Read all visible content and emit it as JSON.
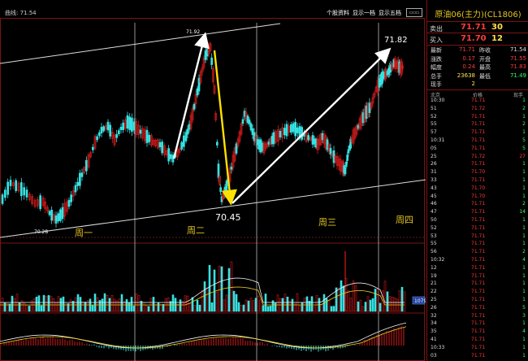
{
  "header": {
    "left_label": "曲线: 71.54",
    "links": [
      "个股资料",
      "显示一档",
      "显示五档"
    ]
  },
  "chart": {
    "annotations": {
      "high_label": "71.82",
      "low_label": "70.45",
      "left_low_label": "70.28",
      "mid_high_label": "71.92",
      "badge": "1079"
    },
    "days": [
      "周一",
      "周二",
      "周三",
      "周四"
    ]
  },
  "quote": {
    "title": "原油06(主力)(CL1806)",
    "sell_label": "卖出",
    "sell_price": "71.71",
    "sell_vol": "30",
    "buy_label": "买入",
    "buy_price": "71.70",
    "buy_vol": "12",
    "stats": [
      {
        "l1": "最新",
        "v1": "71.71",
        "c1": "#ff3b3b",
        "l2": "昨收",
        "v2": "71.54",
        "c2": "#dddddd"
      },
      {
        "l1": "涨跌",
        "v1": "0.17",
        "c1": "#ff3b3b",
        "l2": "开盘",
        "v2": "71.55",
        "c2": "#ff3b3b"
      },
      {
        "l1": "幅度",
        "v1": "0.24",
        "c1": "#ff3b3b",
        "l2": "最高",
        "v2": "71.83",
        "c2": "#ff3b3b"
      },
      {
        "l1": "总手",
        "v1": "23638",
        "c1": "#ffe14a",
        "l2": "最低",
        "v2": "71.49",
        "c2": "#3dff6b"
      },
      {
        "l1": "现手",
        "v1": "2",
        "c1": "#ffe14a",
        "l2": "",
        "v2": "",
        "c2": "#dddddd"
      }
    ],
    "tick_header": [
      "北京",
      "价格",
      "现手"
    ],
    "ticks": [
      {
        "t": "10:30",
        "p": "71.71",
        "v": "1",
        "pc": "#ff3b3b",
        "vc": "#3dff6b"
      },
      {
        "t": "51",
        "p": "71.72",
        "v": "2",
        "pc": "#ff3b3b",
        "vc": "#3dff6b"
      },
      {
        "t": "52",
        "p": "71.71",
        "v": "1",
        "pc": "#ff3b3b",
        "vc": "#3dff6b"
      },
      {
        "t": "55",
        "p": "71.71",
        "v": "2",
        "pc": "#ff3b3b",
        "vc": "#3dff6b"
      },
      {
        "t": "57",
        "p": "71.71",
        "v": "1",
        "pc": "#ff3b3b",
        "vc": "#3dff6b"
      },
      {
        "t": "10:31",
        "p": "71.71",
        "v": "5",
        "pc": "#ff3b3b",
        "vc": "#3dff6b"
      },
      {
        "t": "05",
        "p": "71.71",
        "v": "5",
        "pc": "#ff3b3b",
        "vc": "#3dff6b"
      },
      {
        "t": "25",
        "p": "71.72",
        "v": "27",
        "pc": "#ff3b3b",
        "vc": "#ff3b3b"
      },
      {
        "t": "26",
        "p": "71.71",
        "v": "1",
        "pc": "#ff3b3b",
        "vc": "#3dff6b"
      },
      {
        "t": "31",
        "p": "71.70",
        "v": "1",
        "pc": "#ff3b3b",
        "vc": "#3dff6b"
      },
      {
        "t": "33",
        "p": "71.71",
        "v": "1",
        "pc": "#ff3b3b",
        "vc": "#3dff6b"
      },
      {
        "t": "43",
        "p": "71.70",
        "v": "1",
        "pc": "#ff3b3b",
        "vc": "#3dff6b"
      },
      {
        "t": "45",
        "p": "71.70",
        "v": "1",
        "pc": "#ff3b3b",
        "vc": "#3dff6b"
      },
      {
        "t": "46",
        "p": "71.71",
        "v": "2",
        "pc": "#ff3b3b",
        "vc": "#3dff6b"
      },
      {
        "t": "47",
        "p": "71.71",
        "v": "14",
        "pc": "#ff3b3b",
        "vc": "#3dff6b"
      },
      {
        "t": "50",
        "p": "71.71",
        "v": "1",
        "pc": "#ff3b3b",
        "vc": "#3dff6b"
      },
      {
        "t": "52",
        "p": "71.71",
        "v": "1",
        "pc": "#ff3b3b",
        "vc": "#3dff6b"
      },
      {
        "t": "53",
        "p": "71.71",
        "v": "1",
        "pc": "#ff3b3b",
        "vc": "#3dff6b"
      },
      {
        "t": "55",
        "p": "71.71",
        "v": "1",
        "pc": "#ff3b3b",
        "vc": "#3dff6b"
      },
      {
        "t": "56",
        "p": "71.71",
        "v": "2",
        "pc": "#ff3b3b",
        "vc": "#3dff6b"
      },
      {
        "t": "10:32",
        "p": "71.71",
        "v": "4",
        "pc": "#ff3b3b",
        "vc": "#3dff6b"
      },
      {
        "t": "12",
        "p": "71.71",
        "v": "1",
        "pc": "#ff3b3b",
        "vc": "#3dff6b"
      },
      {
        "t": "19",
        "p": "71.71",
        "v": "1",
        "pc": "#ff3b3b",
        "vc": "#3dff6b"
      },
      {
        "t": "21",
        "p": "71.71",
        "v": "1",
        "pc": "#ff3b3b",
        "vc": "#3dff6b"
      },
      {
        "t": "22",
        "p": "71.71",
        "v": "1",
        "pc": "#ff3b3b",
        "vc": "#3dff6b"
      },
      {
        "t": "25",
        "p": "71.71",
        "v": "1",
        "pc": "#ff3b3b",
        "vc": "#3dff6b"
      },
      {
        "t": "26",
        "p": "71.71",
        "v": "5",
        "pc": "#ff3b3b",
        "vc": "#3dff6b"
      },
      {
        "t": "32",
        "p": "71.71",
        "v": "3",
        "pc": "#ff3b3b",
        "vc": "#3dff6b"
      },
      {
        "t": "34",
        "p": "71.71",
        "v": "1",
        "pc": "#ff3b3b",
        "vc": "#3dff6b"
      },
      {
        "t": "35",
        "p": "71.71",
        "v": "4",
        "pc": "#ff3b3b",
        "vc": "#3dff6b"
      },
      {
        "t": "41",
        "p": "71.71",
        "v": "1",
        "pc": "#ff3b3b",
        "vc": "#3dff6b"
      },
      {
        "t": "10:33",
        "p": "71.71",
        "v": "1",
        "pc": "#ff3b3b",
        "vc": "#3dff6b"
      },
      {
        "t": "03",
        "p": "71.71",
        "v": "1",
        "pc": "#ff3b3b",
        "vc": "#3dff6b"
      }
    ]
  }
}
